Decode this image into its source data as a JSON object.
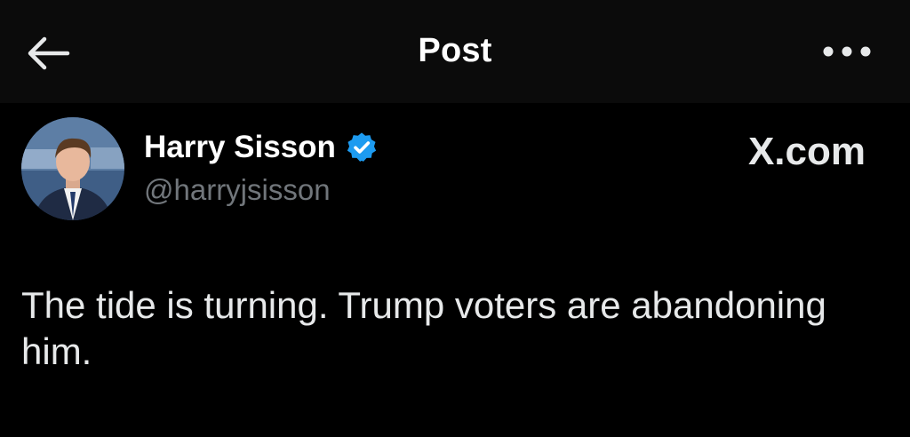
{
  "header": {
    "title": "Post",
    "back_icon": "arrow-left-icon",
    "more_icon": "more-horizontal-icon"
  },
  "post": {
    "author": {
      "display_name": "Harry Sisson",
      "handle": "@harryjsisson",
      "verified": true,
      "verified_color": "#1d9bf0"
    },
    "watermark": "X.com",
    "text": "The tide is turning. Trump voters are abandoning him."
  },
  "colors": {
    "background": "#000000",
    "header_background": "#0b0b0b",
    "primary_text": "#e7e9ea",
    "secondary_text": "#71767b",
    "accent": "#1d9bf0"
  }
}
